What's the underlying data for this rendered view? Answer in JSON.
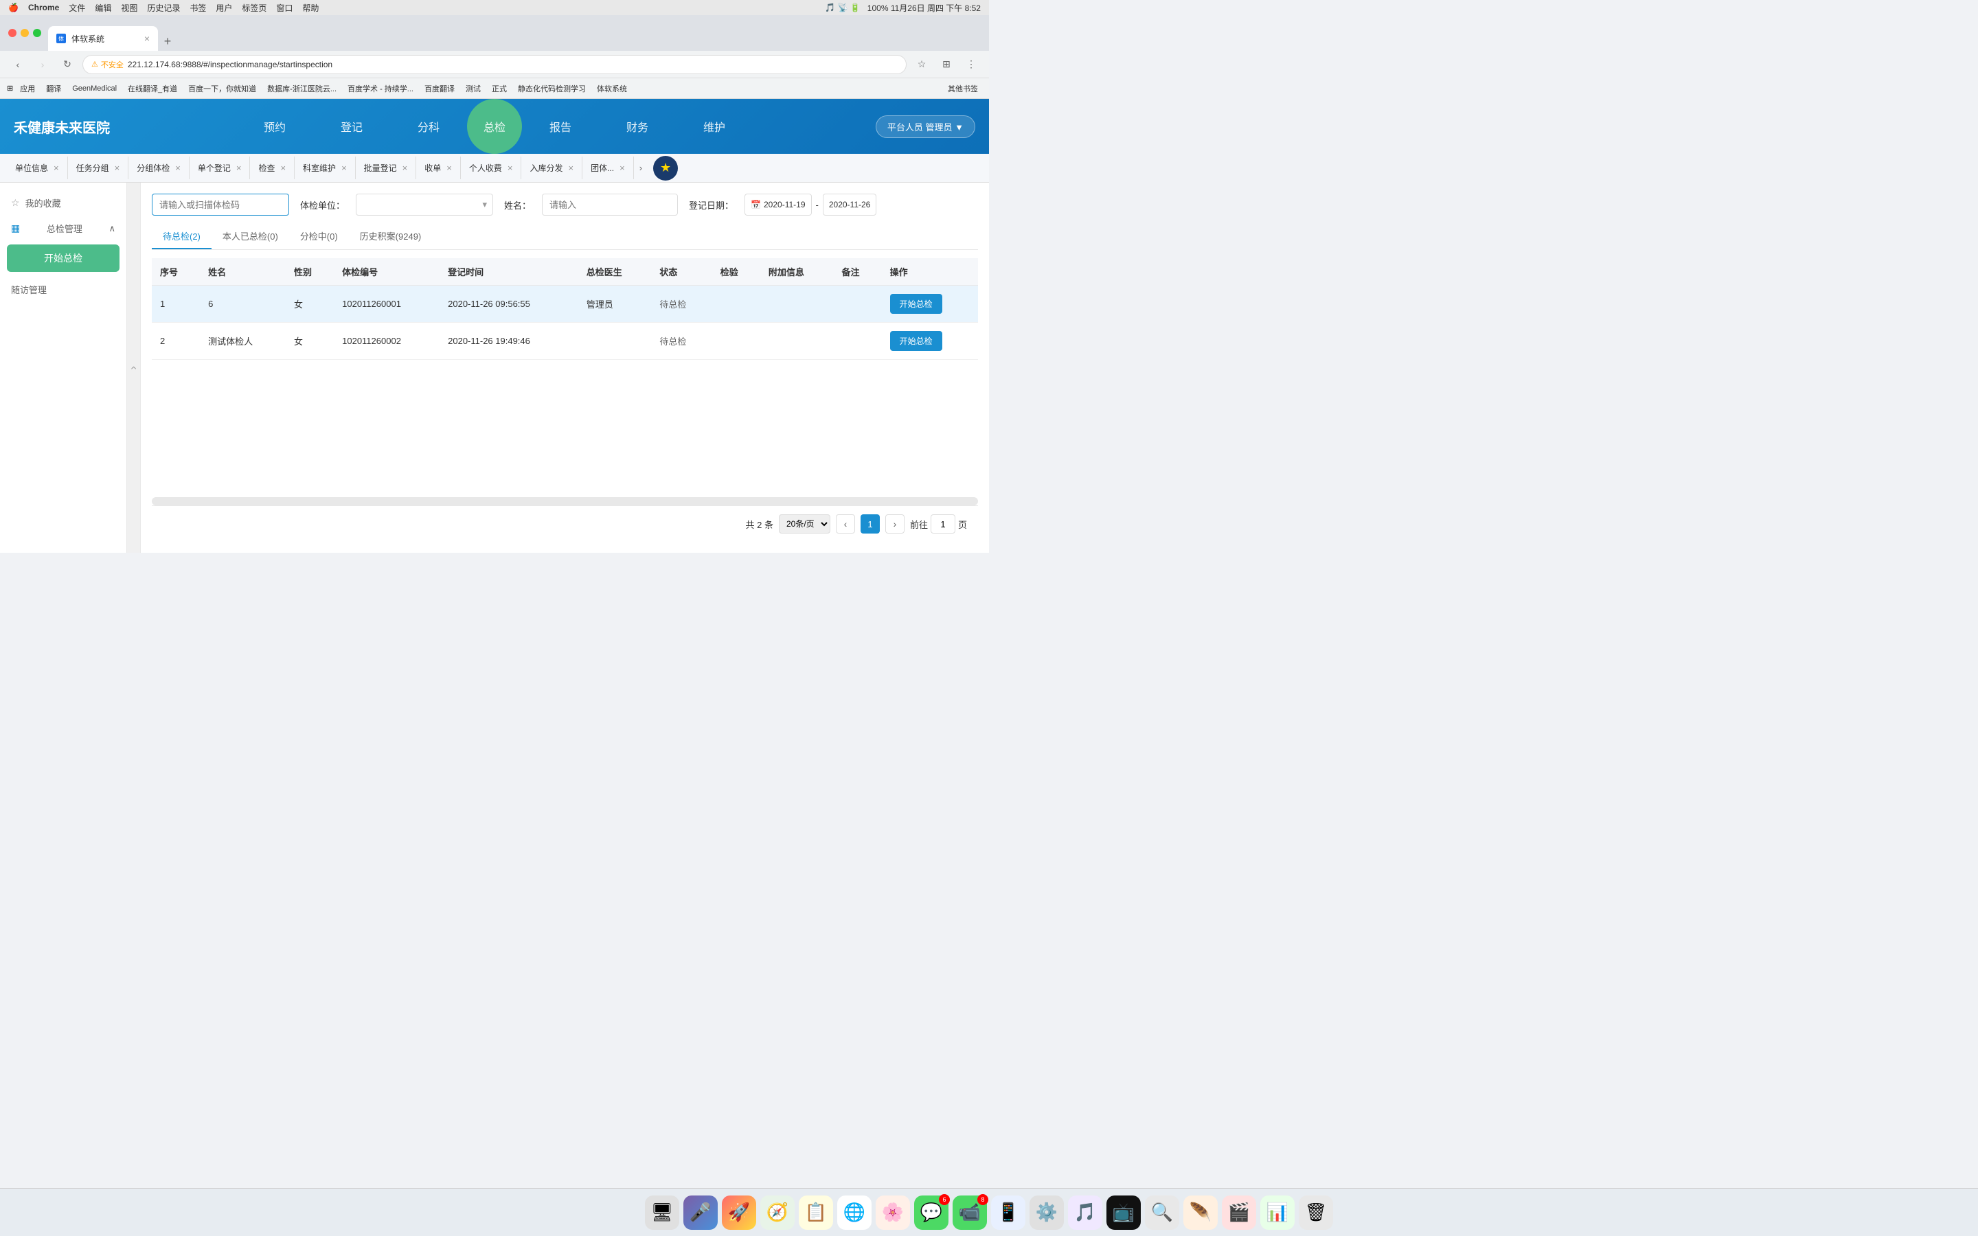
{
  "macos": {
    "apple": "🍎",
    "left_menus": [
      "Chrome",
      "文件",
      "编辑",
      "视图",
      "历史记录",
      "书签",
      "用户",
      "标签页",
      "窗口",
      "帮助"
    ],
    "right_info": "100%  11月26日 周四 下午 8:52",
    "time": "下午 8:52"
  },
  "browser": {
    "tab_title": "体软系统",
    "tab_favicon": "体",
    "address": "221.12.174.68:9888/#/inspectionmanage/startinspection",
    "security_label": "不安全",
    "bookmarks": [
      "应用",
      "翻译",
      "GeenMedical",
      "在线翻译_有道",
      "百度一下，你就知道",
      "数据库-浙江医院云...",
      "百度学术 - 持续学...",
      "百度翻译",
      "测试",
      "正式",
      "静态化代码检测学习",
      "体软系统",
      "其他书签"
    ]
  },
  "app": {
    "logo": "禾健康未来医院",
    "nav_items": [
      "预约",
      "登记",
      "分科",
      "总检",
      "报告",
      "财务",
      "维护"
    ],
    "active_nav": "总检",
    "user_btn": "平台人员 管理员 ▼"
  },
  "tabs": {
    "items": [
      {
        "label": "单位信息",
        "closable": true
      },
      {
        "label": "任务分组",
        "closable": true
      },
      {
        "label": "分组体检",
        "closable": true
      },
      {
        "label": "单个登记",
        "closable": true
      },
      {
        "label": "检查",
        "closable": true
      },
      {
        "label": "科室维护",
        "closable": true
      },
      {
        "label": "批量登记",
        "closable": true
      },
      {
        "label": "收单",
        "closable": true
      },
      {
        "label": "个人收费",
        "closable": true
      },
      {
        "label": "入库分发",
        "closable": true
      },
      {
        "label": "团体...",
        "closable": true
      }
    ],
    "more_icon": "›"
  },
  "sidebar": {
    "favorites_label": "我的收藏",
    "section_label": "总检管理",
    "active_btn_label": "开始总检",
    "follow_up_label": "随访管理"
  },
  "search": {
    "code_placeholder": "请输入或扫描体检码",
    "unit_label": "体检单位：",
    "unit_placeholder": "",
    "name_label": "姓名：",
    "name_placeholder": "请输入",
    "date_label": "登记日期：",
    "date_start": "2020-11-19",
    "date_end": "2020-11-26"
  },
  "sub_tabs": [
    {
      "label": "待总检(2)",
      "active": true
    },
    {
      "label": "本人已总检(0)",
      "active": false
    },
    {
      "label": "分检中(0)",
      "active": false
    },
    {
      "label": "历史积案(9249)",
      "active": false
    }
  ],
  "table": {
    "columns": [
      "序号",
      "姓名",
      "性别",
      "体检编号",
      "登记时间",
      "总检医生",
      "状态",
      "检验",
      "附加信息",
      "备注",
      "操作"
    ],
    "rows": [
      {
        "seq": "1",
        "name": "6",
        "gender": "女",
        "code": "102011260001",
        "reg_time": "2020-11-26 09:56:55",
        "doctor": "管理员",
        "status": "待总检",
        "inspection": "",
        "extra": "",
        "note": "",
        "action": "开始总检",
        "highlighted": true
      },
      {
        "seq": "2",
        "name": "测试体检人",
        "gender": "女",
        "code": "102011260002",
        "reg_time": "2020-11-26 19:49:46",
        "doctor": "",
        "status": "待总检",
        "inspection": "",
        "extra": "",
        "note": "",
        "action": "开始总检",
        "highlighted": false
      }
    ]
  },
  "pagination": {
    "total_text": "共 2 条",
    "page_size": "20条/页",
    "current_page": "1",
    "prev_label": "‹",
    "next_label": "›",
    "jump_prefix": "前往",
    "jump_suffix": "页",
    "jump_value": "1"
  },
  "dock": {
    "items": [
      {
        "icon": "🖥",
        "badge": null,
        "name": "finder"
      },
      {
        "icon": "🎤",
        "badge": null,
        "name": "siri"
      },
      {
        "icon": "🚀",
        "badge": null,
        "name": "launchpad"
      },
      {
        "icon": "🧭",
        "badge": null,
        "name": "safari"
      },
      {
        "icon": "📋",
        "badge": null,
        "name": "notes"
      },
      {
        "icon": "🔵",
        "badge": null,
        "name": "chrome"
      },
      {
        "icon": "🌸",
        "badge": null,
        "name": "photos"
      },
      {
        "icon": "💬",
        "badge": "6",
        "name": "messages"
      },
      {
        "icon": "📹",
        "badge": "8",
        "name": "facetime"
      },
      {
        "icon": "📱",
        "badge": null,
        "name": "appstore"
      },
      {
        "icon": "⚙️",
        "badge": null,
        "name": "system-prefs"
      },
      {
        "icon": "🎵",
        "badge": null,
        "name": "podcasts"
      },
      {
        "icon": "📺",
        "badge": null,
        "name": "appletv"
      },
      {
        "icon": "🔍",
        "badge": null,
        "name": "quicksilver"
      },
      {
        "icon": "💬",
        "badge": null,
        "name": "msg2"
      },
      {
        "icon": "🪶",
        "badge": null,
        "name": "paw"
      },
      {
        "icon": "🎬",
        "badge": null,
        "name": "quicktime"
      },
      {
        "icon": "📊",
        "badge": null,
        "name": "numbers"
      },
      {
        "icon": "🗑",
        "badge": null,
        "name": "trash"
      }
    ]
  }
}
